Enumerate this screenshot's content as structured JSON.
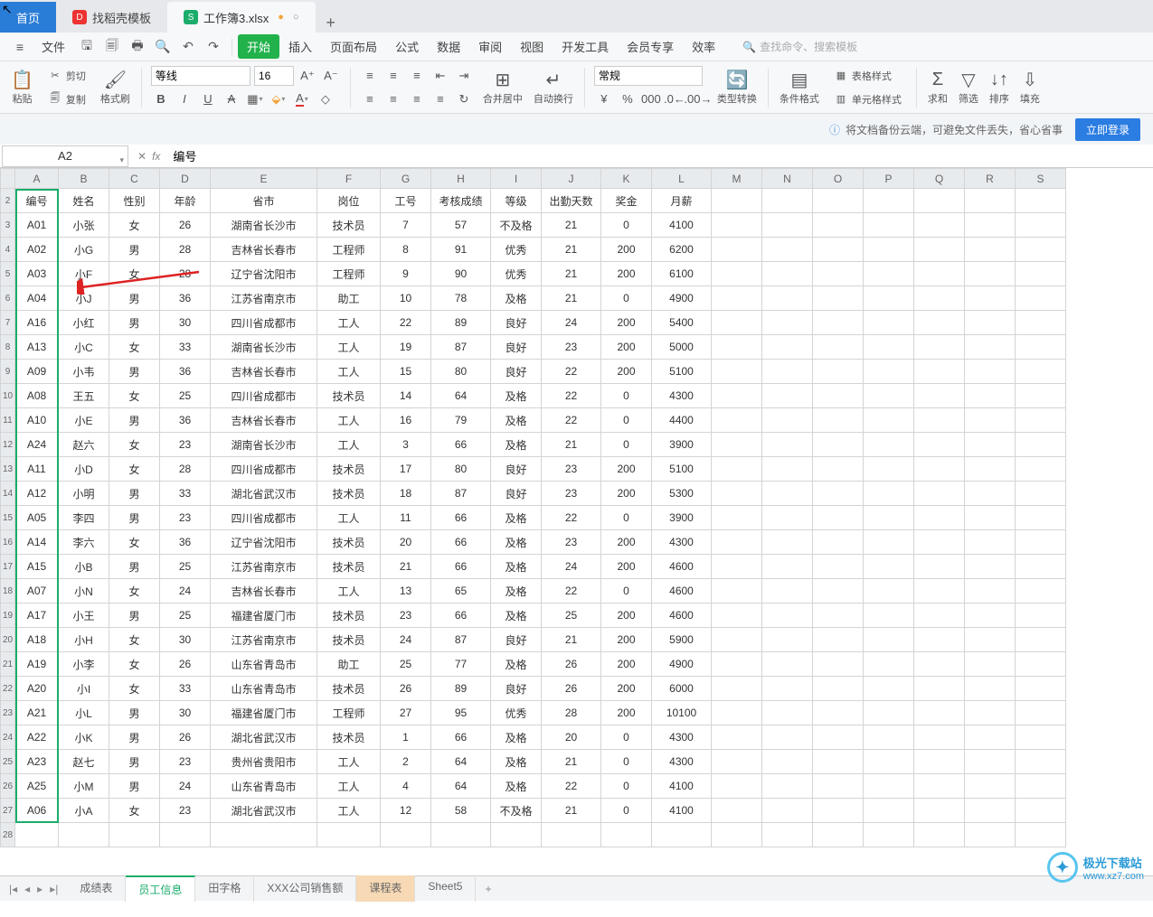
{
  "titleTabs": {
    "home": "首页",
    "template": "找稻壳模板",
    "file": "工作簿3.xlsx"
  },
  "menubar": {
    "file": "文件",
    "items": [
      "开始",
      "插入",
      "页面布局",
      "公式",
      "数据",
      "审阅",
      "视图",
      "开发工具",
      "会员专享",
      "效率"
    ],
    "searchPlaceholder": "查找命令、搜索模板"
  },
  "ribbon": {
    "paste": "粘贴",
    "cut": "剪切",
    "copy": "复制",
    "formatPainter": "格式刷",
    "font": "等线",
    "fontSize": "16",
    "merge": "合并居中",
    "wrap": "自动换行",
    "numFmt": "常规",
    "typeCvt": "类型转换",
    "condFmt": "条件格式",
    "tblStyle": "表格样式",
    "cellStyle": "单元格样式",
    "sum": "求和",
    "filter": "筛选",
    "sort": "排序",
    "fill": "填充"
  },
  "cloud": {
    "text": "将文档备份云端，可避免文件丢失，省心省事",
    "login": "立即登录"
  },
  "nameBox": "A2",
  "formula": "编号",
  "columns": [
    "A",
    "B",
    "C",
    "D",
    "E",
    "F",
    "G",
    "H",
    "I",
    "J",
    "K",
    "L",
    "M",
    "N",
    "O",
    "P",
    "Q",
    "R",
    "S"
  ],
  "headers": [
    "编号",
    "姓名",
    "性别",
    "年龄",
    "省市",
    "岗位",
    "工号",
    "考核成绩",
    "等级",
    "出勤天数",
    "奖金",
    "月薪"
  ],
  "rows": [
    [
      "A01",
      "小张",
      "女",
      "26",
      "湖南省长沙市",
      "技术员",
      "7",
      "57",
      "不及格",
      "21",
      "0",
      "4100"
    ],
    [
      "A02",
      "小G",
      "男",
      "28",
      "吉林省长春市",
      "工程师",
      "8",
      "91",
      "优秀",
      "21",
      "200",
      "6200"
    ],
    [
      "A03",
      "小F",
      "女",
      "28",
      "辽宁省沈阳市",
      "工程师",
      "9",
      "90",
      "优秀",
      "21",
      "200",
      "6100"
    ],
    [
      "A04",
      "小J",
      "男",
      "36",
      "江苏省南京市",
      "助工",
      "10",
      "78",
      "及格",
      "21",
      "0",
      "4900"
    ],
    [
      "A16",
      "小红",
      "男",
      "30",
      "四川省成都市",
      "工人",
      "22",
      "89",
      "良好",
      "24",
      "200",
      "5400"
    ],
    [
      "A13",
      "小C",
      "女",
      "33",
      "湖南省长沙市",
      "工人",
      "19",
      "87",
      "良好",
      "23",
      "200",
      "5000"
    ],
    [
      "A09",
      "小韦",
      "男",
      "36",
      "吉林省长春市",
      "工人",
      "15",
      "80",
      "良好",
      "22",
      "200",
      "5100"
    ],
    [
      "A08",
      "王五",
      "女",
      "25",
      "四川省成都市",
      "技术员",
      "14",
      "64",
      "及格",
      "22",
      "0",
      "4300"
    ],
    [
      "A10",
      "小E",
      "男",
      "36",
      "吉林省长春市",
      "工人",
      "16",
      "79",
      "及格",
      "22",
      "0",
      "4400"
    ],
    [
      "A24",
      "赵六",
      "女",
      "23",
      "湖南省长沙市",
      "工人",
      "3",
      "66",
      "及格",
      "21",
      "0",
      "3900"
    ],
    [
      "A11",
      "小D",
      "女",
      "28",
      "四川省成都市",
      "技术员",
      "17",
      "80",
      "良好",
      "23",
      "200",
      "5100"
    ],
    [
      "A12",
      "小明",
      "男",
      "33",
      "湖北省武汉市",
      "技术员",
      "18",
      "87",
      "良好",
      "23",
      "200",
      "5300"
    ],
    [
      "A05",
      "李四",
      "男",
      "23",
      "四川省成都市",
      "工人",
      "11",
      "66",
      "及格",
      "22",
      "0",
      "3900"
    ],
    [
      "A14",
      "李六",
      "女",
      "36",
      "辽宁省沈阳市",
      "技术员",
      "20",
      "66",
      "及格",
      "23",
      "200",
      "4300"
    ],
    [
      "A15",
      "小B",
      "男",
      "25",
      "江苏省南京市",
      "技术员",
      "21",
      "66",
      "及格",
      "24",
      "200",
      "4600"
    ],
    [
      "A07",
      "小N",
      "女",
      "24",
      "吉林省长春市",
      "工人",
      "13",
      "65",
      "及格",
      "22",
      "0",
      "4600"
    ],
    [
      "A17",
      "小王",
      "男",
      "25",
      "福建省厦门市",
      "技术员",
      "23",
      "66",
      "及格",
      "25",
      "200",
      "4600"
    ],
    [
      "A18",
      "小H",
      "女",
      "30",
      "江苏省南京市",
      "技术员",
      "24",
      "87",
      "良好",
      "21",
      "200",
      "5900"
    ],
    [
      "A19",
      "小李",
      "女",
      "26",
      "山东省青岛市",
      "助工",
      "25",
      "77",
      "及格",
      "26",
      "200",
      "4900"
    ],
    [
      "A20",
      "小I",
      "女",
      "33",
      "山东省青岛市",
      "技术员",
      "26",
      "89",
      "良好",
      "26",
      "200",
      "6000"
    ],
    [
      "A21",
      "小L",
      "男",
      "30",
      "福建省厦门市",
      "工程师",
      "27",
      "95",
      "优秀",
      "28",
      "200",
      "10100"
    ],
    [
      "A22",
      "小K",
      "男",
      "26",
      "湖北省武汉市",
      "技术员",
      "1",
      "66",
      "及格",
      "20",
      "0",
      "4300"
    ],
    [
      "A23",
      "赵七",
      "男",
      "23",
      "贵州省贵阳市",
      "工人",
      "2",
      "64",
      "及格",
      "21",
      "0",
      "4300"
    ],
    [
      "A25",
      "小M",
      "男",
      "24",
      "山东省青岛市",
      "工人",
      "4",
      "64",
      "及格",
      "22",
      "0",
      "4100"
    ],
    [
      "A06",
      "小A",
      "女",
      "23",
      "湖北省武汉市",
      "工人",
      "12",
      "58",
      "不及格",
      "21",
      "0",
      "4100"
    ]
  ],
  "sheets": [
    "成绩表",
    "员工信息",
    "田字格",
    "XXX公司销售额",
    "课程表",
    "Sheet5"
  ],
  "watermark": {
    "site": "极光下载站",
    "url": "www.xz7.com"
  }
}
